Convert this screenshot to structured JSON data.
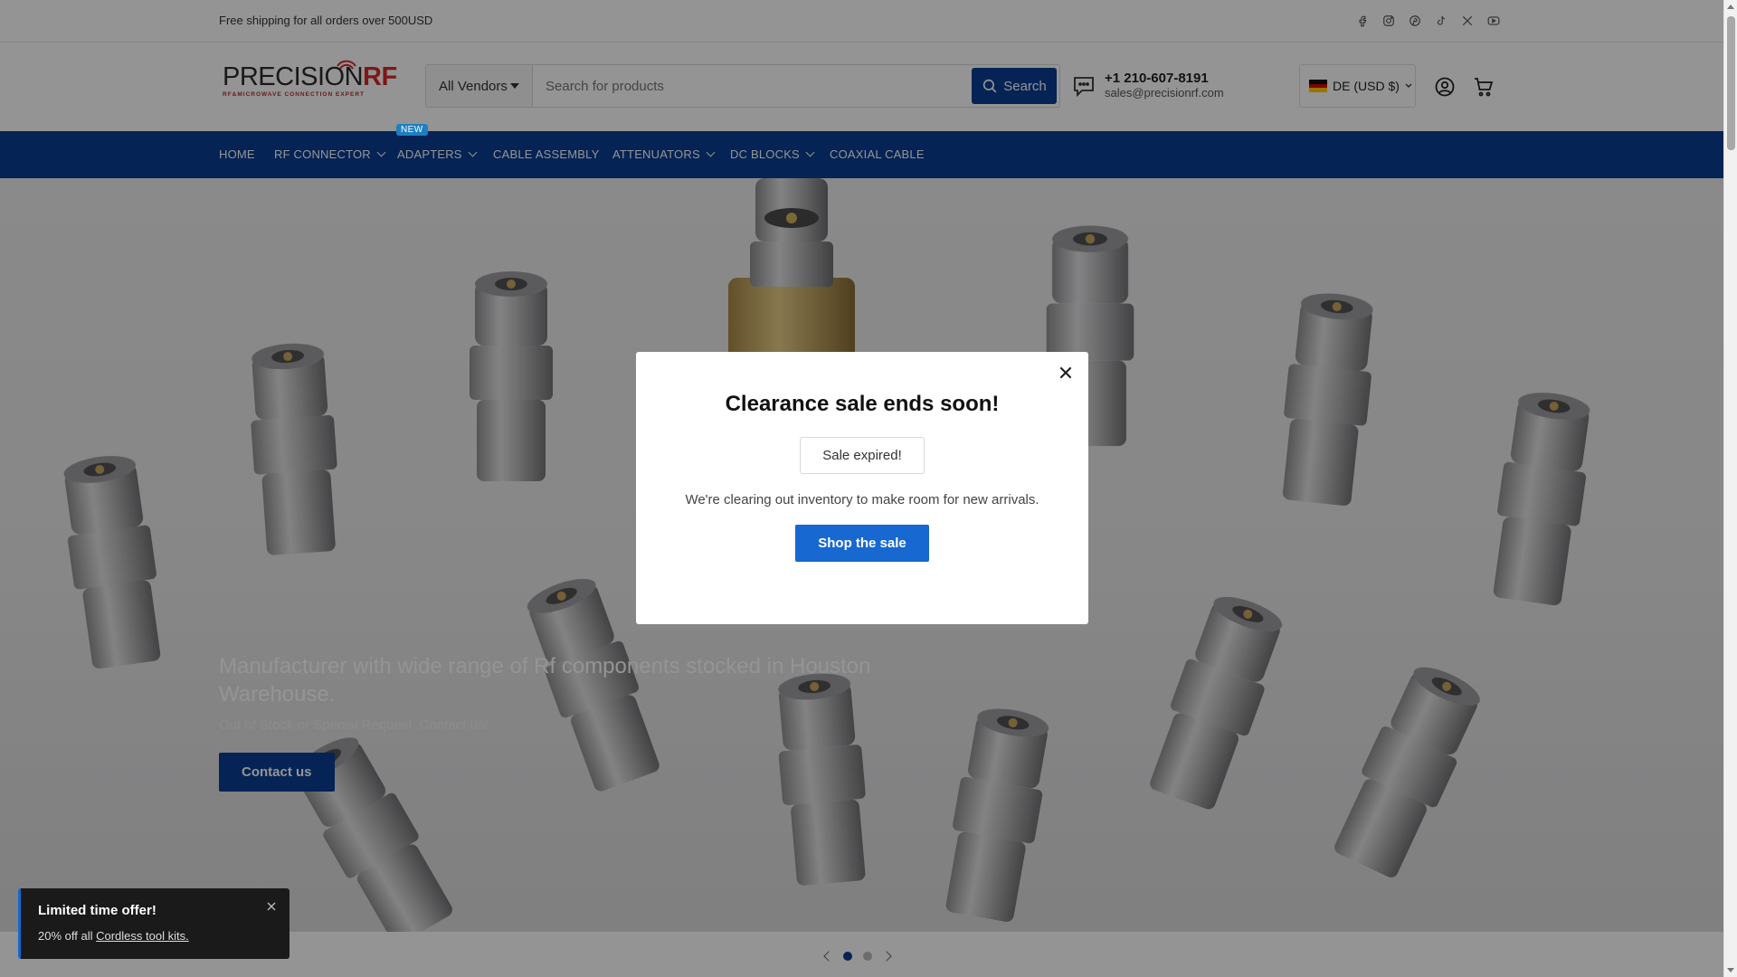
{
  "announcement": {
    "text": "Free shipping for all orders over 500USD"
  },
  "socials": [
    "facebook-icon",
    "instagram-icon",
    "pinterest-icon",
    "tiktok-icon",
    "x-icon",
    "youtube-icon"
  ],
  "logo": {
    "word_main": "PRECISION",
    "word_accent": "RF",
    "tagline": "RF&MICROWAVE CONNECTION EXPERT"
  },
  "search": {
    "vendor": "All Vendors",
    "placeholder": "Search for products",
    "button": "Search"
  },
  "contact": {
    "phone": "+1 210-607-8191",
    "email": "sales@precisionrf.com"
  },
  "currency": {
    "label": "DE (USD $)"
  },
  "nav": {
    "badge": "NEW",
    "items": [
      {
        "label": "HOME"
      },
      {
        "label": "RF CONNECTOR"
      },
      {
        "label": "ADAPTERS"
      },
      {
        "label": "CABLE ASSEMBLY"
      },
      {
        "label": "ATTENUATORS"
      },
      {
        "label": "DC BLOCKS"
      },
      {
        "label": "COAXIAL CABLE"
      }
    ]
  },
  "hero": {
    "title": "Manufacturer with wide range of Rf components stocked in Houston Warehouse.",
    "subtitle": "Out of Stock or Special Request .Contact us!",
    "button": "Contact us",
    "active_slide": 1,
    "slide_count": 2
  },
  "modal": {
    "title": "Clearance sale ends soon!",
    "status": "Sale expired!",
    "description": "We're clearing out inventory to make room for new arrivals.",
    "button": "Shop the sale"
  },
  "toast": {
    "title": "Limited time offer!",
    "body_prefix": "20% off all ",
    "link": "Cordless tool kits."
  },
  "colors": {
    "brand_blue": "#0a3d91",
    "cta_blue": "#1768d0",
    "logo_red": "#d42a2a"
  }
}
